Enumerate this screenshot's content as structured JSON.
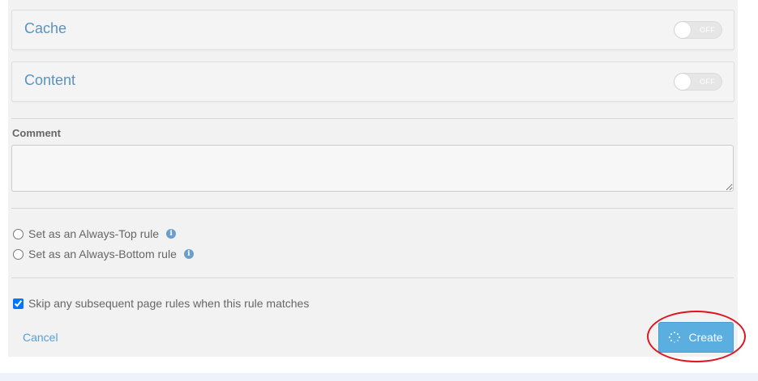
{
  "sections": {
    "cache": {
      "title": "Cache",
      "toggle_label": "OFF"
    },
    "content": {
      "title": "Content",
      "toggle_label": "OFF"
    }
  },
  "comment": {
    "label": "Comment",
    "value": ""
  },
  "options": {
    "always_top": "Set as an Always-Top rule",
    "always_bottom": "Set as an Always-Bottom rule",
    "skip_subsequent": "Skip any subsequent page rules when this rule matches"
  },
  "actions": {
    "cancel": "Cancel",
    "create": "Create"
  },
  "icons": {
    "info": "i"
  },
  "colors": {
    "accent": "#5aaee0",
    "link": "#58a0d6",
    "highlight": "#e0141e"
  }
}
